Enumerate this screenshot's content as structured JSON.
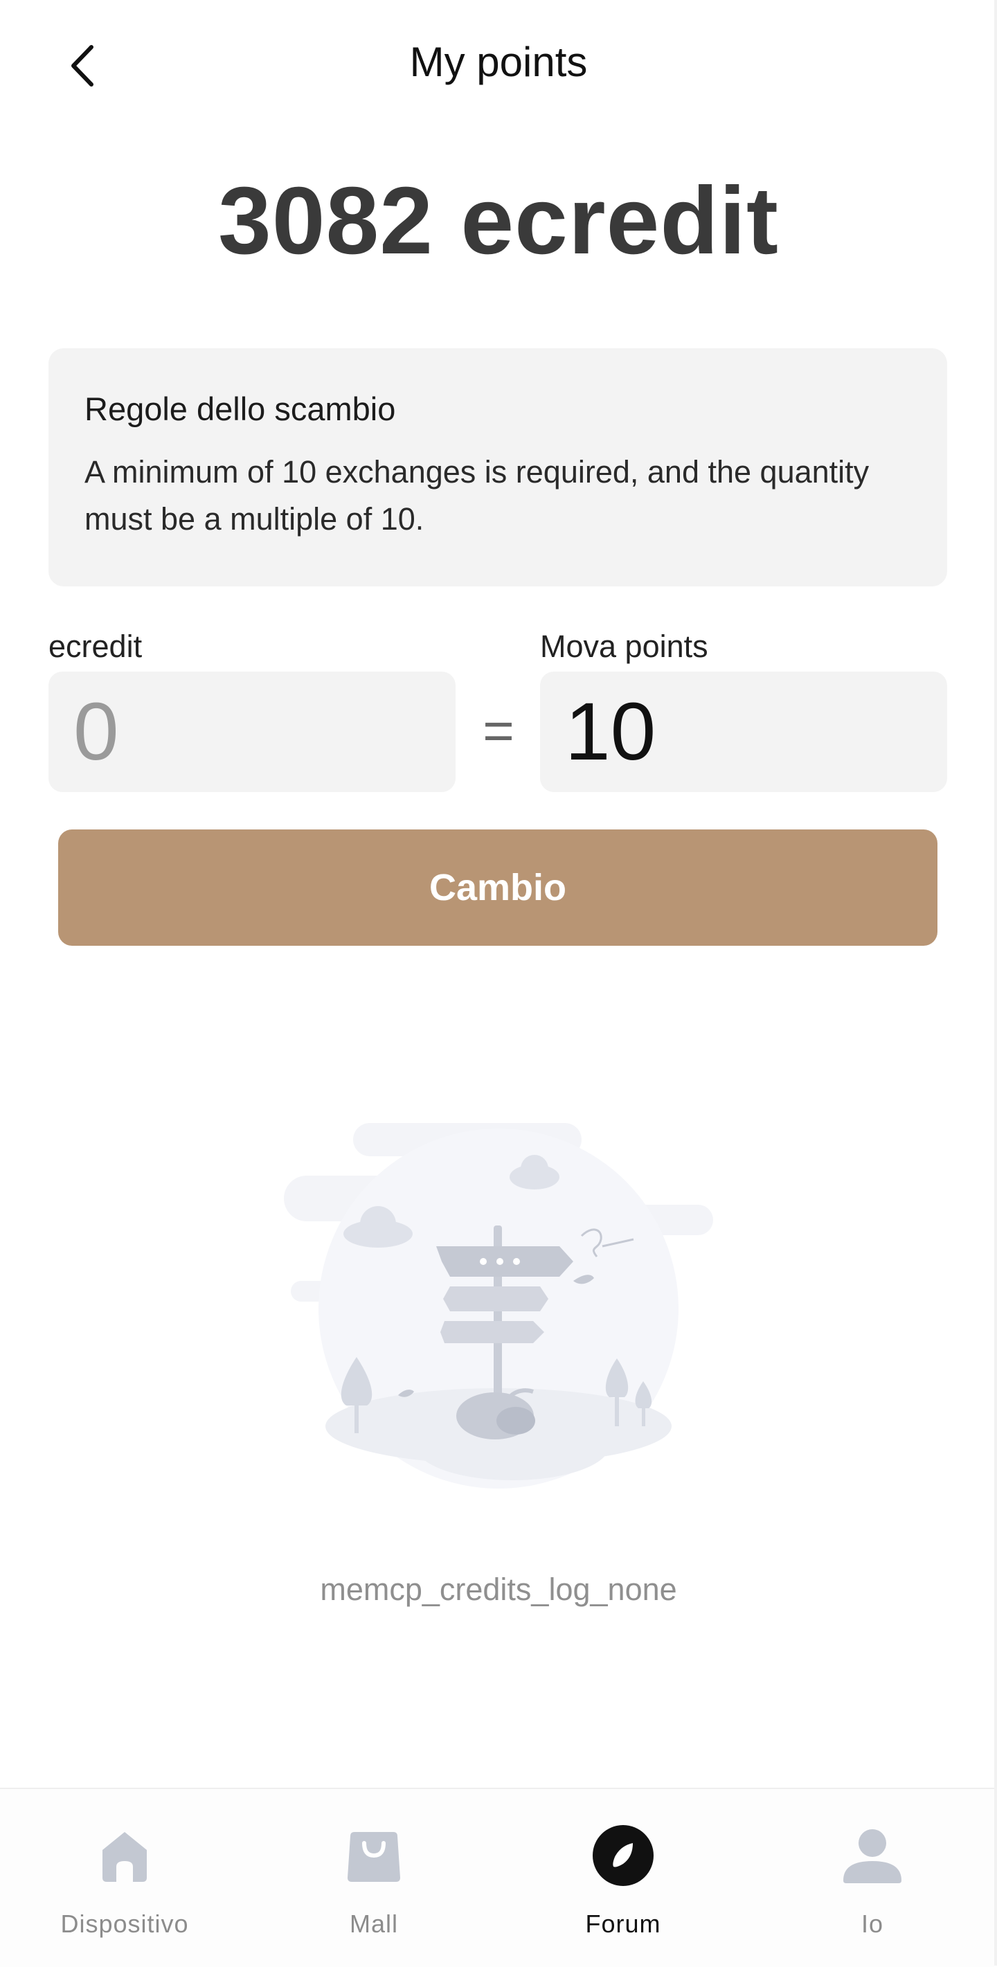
{
  "header": {
    "title": "My points",
    "back_icon": "chevron-left-icon"
  },
  "balance": {
    "text": "3082 ecredit",
    "value": 3082,
    "unit": "ecredit"
  },
  "rules": {
    "title": "Regole dello scambio",
    "text": "A minimum of 10 exchanges is required, and the quantity must be a multiple of 10."
  },
  "exchange": {
    "from_label": "ecredit",
    "from_placeholder": "0",
    "equals": "=",
    "to_label": "Mova points",
    "to_value": "10",
    "button_label": "Cambio",
    "button_color": "#b89574"
  },
  "empty_state": {
    "illustration": "signpost-empty-illustration",
    "text": "memcp_credits_log_none"
  },
  "bottom_nav": {
    "items": [
      {
        "label": "Dispositivo",
        "icon": "home-icon",
        "active": false
      },
      {
        "label": "Mall",
        "icon": "shopping-bag-icon",
        "active": false
      },
      {
        "label": "Forum",
        "icon": "compass-icon",
        "active": true
      },
      {
        "label": "Io",
        "icon": "user-icon",
        "active": false
      }
    ],
    "active_color": "#111111",
    "inactive_color": "#c3c8d2"
  }
}
